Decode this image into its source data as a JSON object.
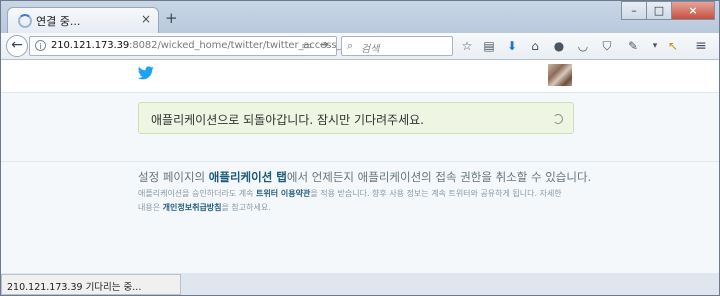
{
  "browser": {
    "tab_title": "연결 중...",
    "tab_close": "×",
    "new_tab": "+",
    "window_controls": {
      "minimize": "–",
      "maximize": "□",
      "close": "×"
    },
    "url_host": "210.121.173.39",
    "url_path": ":8082/wicked_home/twitter/twitter_access_token.ph",
    "search_placeholder": "검색",
    "toolbar_icons": [
      "star-icon",
      "clipboard-icon",
      "download-icon",
      "home-icon",
      "chat-icon",
      "pocket-icon",
      "shield-icon",
      "extension-icon",
      "menu-icon"
    ]
  },
  "page": {
    "notice": "애플리케이션으로 되돌아갑니다. 잠시만 기다려주세요.",
    "settings_line": {
      "pre": "설정 페이지의",
      "link": "애플리케이션 탭",
      "post": "에서 언제든지 애플리케이션의 접속 권한을 취소할 수 있습니다."
    },
    "fine_line1": {
      "pre": "애플리케이션을 승인하더라도 계속",
      "link": "트위터 이용약관",
      "post": "을 적용 받습니다. 향후 사용 정보는 계속 트위터와 공유하게 됩니다. 자세한"
    },
    "fine_line2": {
      "pre": "내용은",
      "link": "개인정보취급방침",
      "post": "을 참고하세요."
    }
  },
  "status_bar": "210.121.173.39 기다리는 중...",
  "colors": {
    "twitter_blue": "#1da1f2",
    "notice_bg": "#eef5e2"
  }
}
